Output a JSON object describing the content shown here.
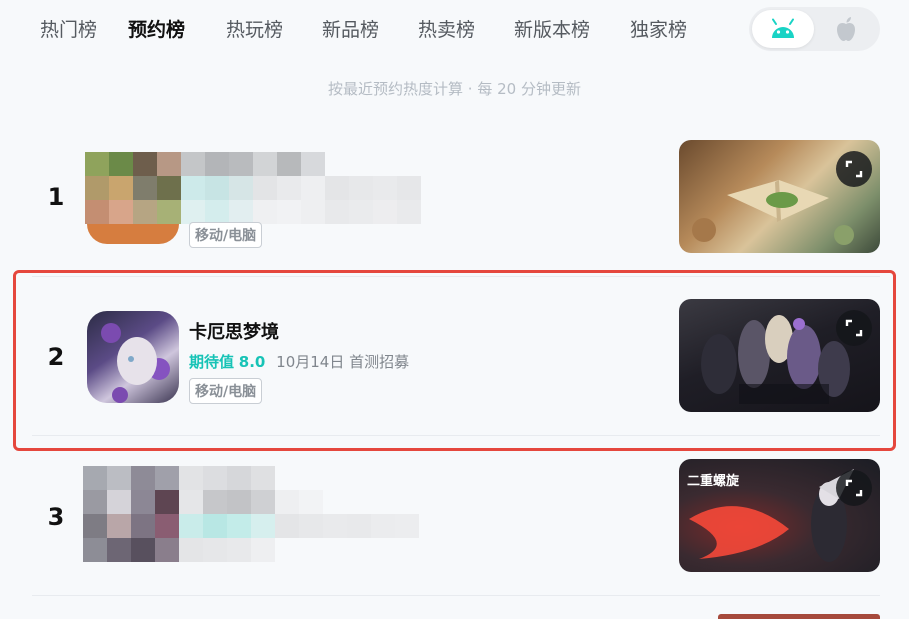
{
  "tabs": [
    {
      "label": "热门榜"
    },
    {
      "label": "预约榜"
    },
    {
      "label": "热玩榜"
    },
    {
      "label": "新品榜"
    },
    {
      "label": "热卖榜"
    },
    {
      "label": "新版本榜"
    },
    {
      "label": "独家榜"
    }
  ],
  "active_tab": "预约榜",
  "subtitle": "按最近预约热度计算 · 每 20 分钟更新",
  "os_switch": {
    "selected": "android",
    "options": [
      "android-icon",
      "apple-icon"
    ]
  },
  "rows": [
    {
      "rank": "1",
      "platform": "移动/电脑"
    },
    {
      "rank": "2",
      "name": "卡厄思梦境",
      "rating_label": "期待值",
      "rating_value": "8.0",
      "date": "10月14日 首测招募",
      "platform": "移动/电脑"
    },
    {
      "rank": "3"
    }
  ],
  "thumb3_caption": "二重螺旋",
  "colors": {
    "accent": "#19d3c5",
    "highlight": "#e5473d"
  }
}
